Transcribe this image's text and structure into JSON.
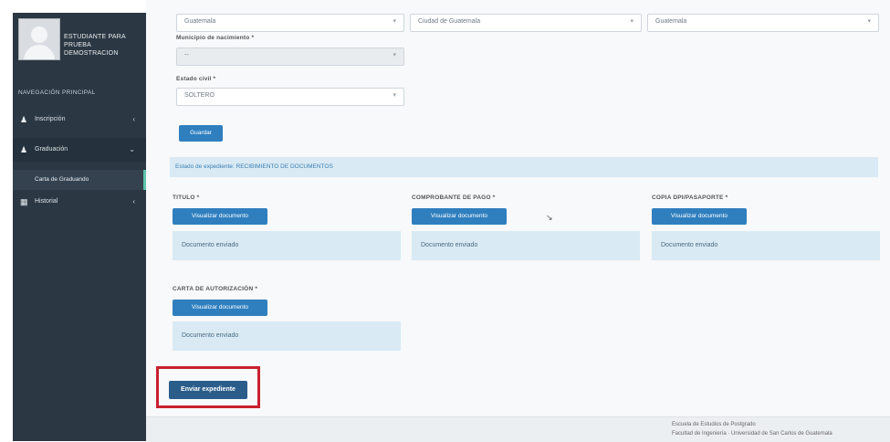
{
  "sidebar": {
    "user_name": "ESTUDIANTE PARA PRUEBA DEMOSTRACION",
    "nav_header": "NAVEGACIÓN PRINCIPAL",
    "items": [
      {
        "icon": "user-icon",
        "label": "Inscripción"
      },
      {
        "icon": "user-icon",
        "label": "Graduación"
      },
      {
        "icon": "table-icon",
        "label": "Historial"
      }
    ],
    "submenu_item": "Carta de Graduando"
  },
  "form": {
    "top_select_1": "Guatemala",
    "top_select_2": "Ciudad de Guatemala",
    "top_select_3": "Guatemala",
    "municipio_label": "Municipio de nacimiento *",
    "municipio_value": "--",
    "estado_civil_label": "Estado civil *",
    "estado_civil_value": "SOLTERO",
    "save_button": "Guardar"
  },
  "info_message": "Estado de expediente: RECIBIMIENTO DE DOCUMENTOS",
  "documents": [
    {
      "label": "TITULO *",
      "button": "Visualizar documento",
      "status": "Documento enviado"
    },
    {
      "label": "COMPROBANTE DE PAGO *",
      "button": "Visualizar documento",
      "status": "Documento enviado"
    },
    {
      "label": "COPIA DPI/PASAPORTE *",
      "button": "Visualizar documento",
      "status": "Documento enviado"
    },
    {
      "label": "CARTA DE AUTORIZACIÓN *",
      "button": "Visualizar documento",
      "status": "Documento enviado"
    }
  ],
  "submit_button": "Enviar expediente",
  "footer": {
    "line1": "Escuela de Estudios de Postgrado",
    "line2": "Facultad de Ingeniería · Universidad de San Carlos de Guatemala"
  },
  "colors": {
    "sidebar_bg": "#2b3743",
    "primary_button": "#2f7fbf",
    "submit_button": "#2b5d8a",
    "info_bg": "#d9eaf4",
    "highlight_border": "#c8202e",
    "active_accent": "#5fc3a9"
  }
}
